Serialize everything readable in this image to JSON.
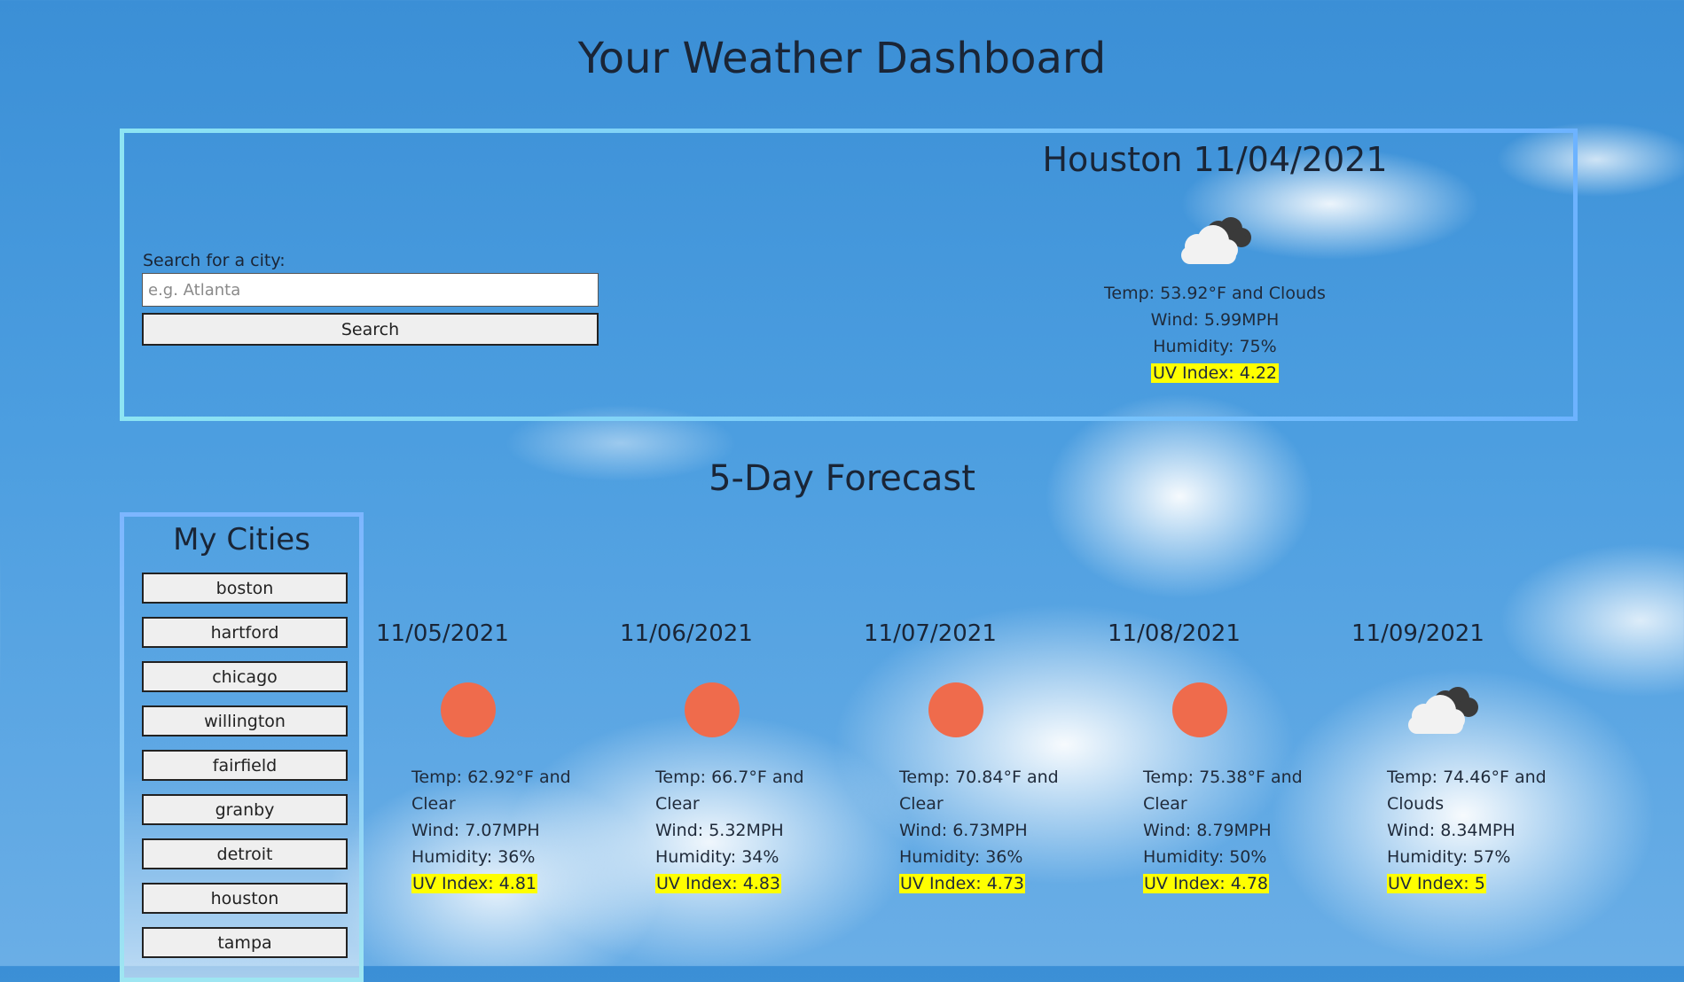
{
  "page_title": "Your Weather Dashboard",
  "search": {
    "label": "Search for a city:",
    "placeholder": "e.g. Atlanta",
    "value": "",
    "button_label": "Search"
  },
  "today": {
    "city_date": "Houston 11/04/2021",
    "icon": "clouds-icon",
    "temp": "Temp: 53.92°F and Clouds",
    "wind": "Wind: 5.99MPH",
    "humidity": "Humidity: 75%",
    "uv": "UV Index: 4.22"
  },
  "forecast_title": "5-Day Forecast",
  "cities": {
    "title": "My Cities",
    "items": [
      "boston",
      "hartford",
      "chicago",
      "willington",
      "fairfield",
      "granby",
      "detroit",
      "houston",
      "tampa"
    ]
  },
  "forecast": [
    {
      "date": "11/05/2021",
      "icon": "clear-sun-icon",
      "temp": "Temp: 62.92°F and Clear",
      "wind": "Wind: 7.07MPH",
      "humidity": "Humidity: 36%",
      "uv": "UV Index: 4.81"
    },
    {
      "date": "11/06/2021",
      "icon": "clear-sun-icon",
      "temp": "Temp: 66.7°F and Clear",
      "wind": "Wind: 5.32MPH",
      "humidity": "Humidity: 34%",
      "uv": "UV Index: 4.83"
    },
    {
      "date": "11/07/2021",
      "icon": "clear-sun-icon",
      "temp": "Temp: 70.84°F and Clear",
      "wind": "Wind: 6.73MPH",
      "humidity": "Humidity: 36%",
      "uv": "UV Index: 4.73"
    },
    {
      "date": "11/08/2021",
      "icon": "clear-sun-icon",
      "temp": "Temp: 75.38°F and Clear",
      "wind": "Wind: 8.79MPH",
      "humidity": "Humidity: 50%",
      "uv": "UV Index: 4.78"
    },
    {
      "date": "11/09/2021",
      "icon": "clouds-icon",
      "temp": "Temp: 74.46°F and Clouds",
      "wind": "Wind: 8.34MPH",
      "humidity": "Humidity: 57%",
      "uv": "UV Index: 5"
    }
  ],
  "colors": {
    "uv_highlight": "#ffff00",
    "sun": "#ef6b4c",
    "panel_border": "#7bd0f4"
  }
}
